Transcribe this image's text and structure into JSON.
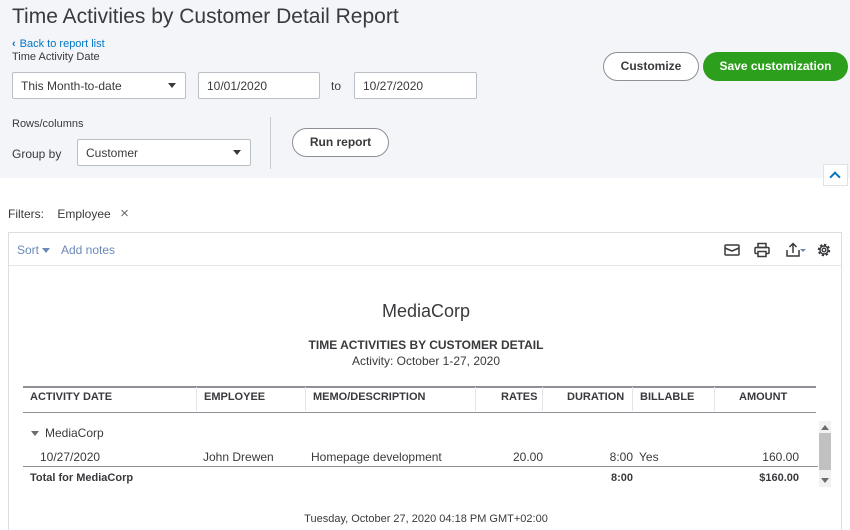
{
  "header": {
    "title": "Time Activities by Customer Detail Report",
    "back_link": "Back to report list"
  },
  "controls": {
    "date_label": "Time Activity Date",
    "date_range": "This Month-to-date",
    "from_date": "10/01/2020",
    "to_label": "to",
    "to_date": "10/27/2020",
    "rows_columns_label": "Rows/columns",
    "group_by_label": "Group by",
    "group_by_value": "Customer",
    "run_report": "Run report",
    "customize": "Customize",
    "save_customization": "Save customization"
  },
  "filters": {
    "label": "Filters:",
    "chip": "Employee"
  },
  "toolbar": {
    "sort": "Sort",
    "add_notes": "Add notes",
    "icons": [
      "email-icon",
      "print-icon",
      "export-icon",
      "settings-gear-icon"
    ]
  },
  "report": {
    "company": "MediaCorp",
    "title": "TIME ACTIVITIES BY CUSTOMER DETAIL",
    "subtitle": "Activity: October 1-27, 2020",
    "columns": [
      "ACTIVITY DATE",
      "EMPLOYEE",
      "MEMO/DESCRIPTION",
      "RATES",
      "DURATION",
      "BILLABLE",
      "AMOUNT"
    ],
    "group": "MediaCorp",
    "rows": [
      {
        "activity_date": "10/27/2020",
        "employee": "John Drewen",
        "memo": "Homepage development",
        "rates": "20.00",
        "duration": "8:00",
        "billable": "Yes",
        "amount": "160.00"
      }
    ],
    "total": {
      "label": "Total for MediaCorp",
      "duration": "8:00",
      "amount": "$160.00"
    },
    "footer_timestamp": "Tuesday, October 27, 2020   04:18 PM GMT+02:00"
  },
  "colors": {
    "accent_green": "#2ca01c",
    "link_blue": "#0077c5",
    "panel_bg": "#f4f5f8"
  }
}
